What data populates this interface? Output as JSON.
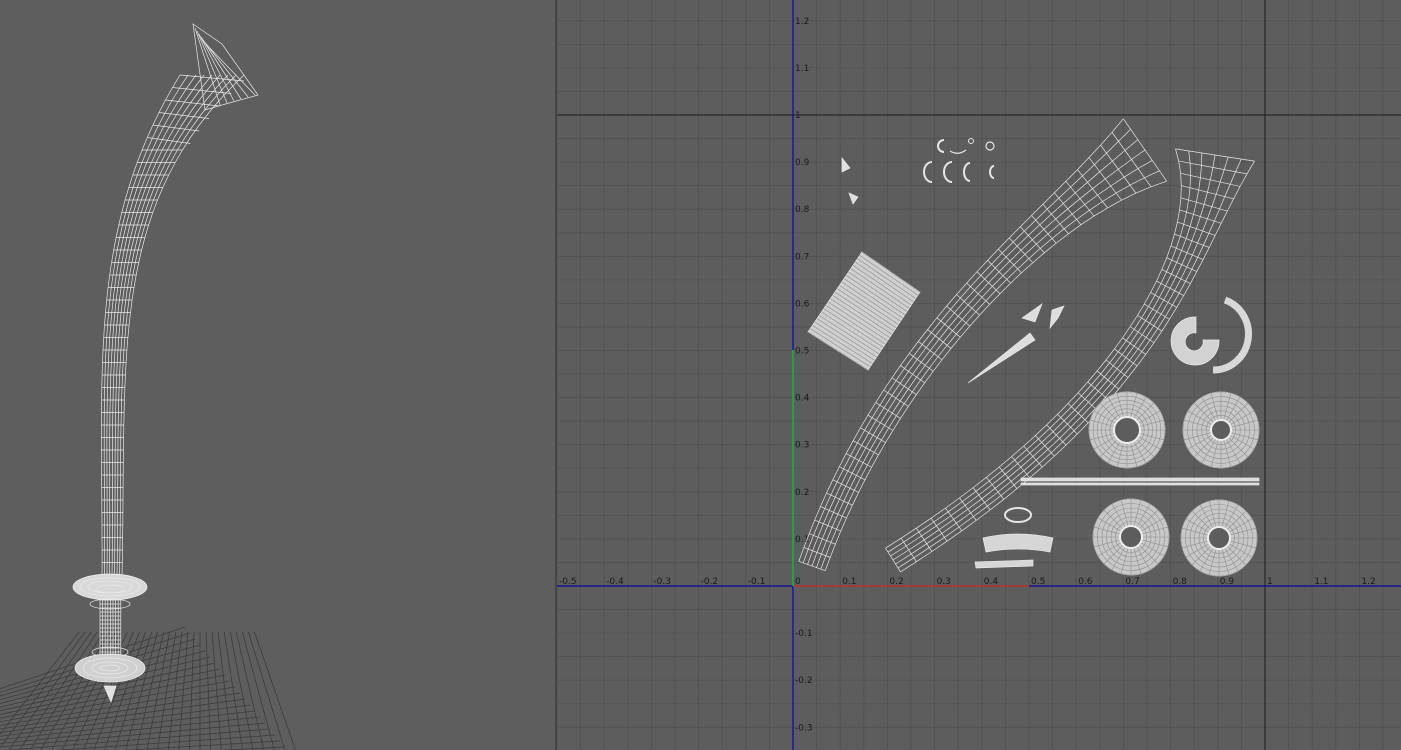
{
  "viewport_3d": {
    "object": "wireframe-sword-model",
    "wire_color": "#e8e8e8",
    "ground_grid_color": "#3a3a3a",
    "background_color": "#5e5e5e"
  },
  "uv_editor": {
    "background_color": "#5d5d5d",
    "grid_color": "#4f4f4f",
    "axis_color": "#0000a0",
    "u_axis_highlight": "#c0392b",
    "v_axis_highlight": "#27ae60",
    "uv_range_border": "#1a1a1a",
    "shell_color": "#e6e6e6",
    "x_ticks": [
      "-0.5",
      "-0.4",
      "-0.3",
      "-0.2",
      "-0.1",
      "0",
      "0.1",
      "0.2",
      "0.3",
      "0.4",
      "0.5",
      "0.6",
      "0.7",
      "0.8",
      "0.9",
      "1",
      "1.1",
      "1.2"
    ],
    "y_ticks": [
      "1.2",
      "1.1",
      "1",
      "0.9",
      "0.8",
      "0.7",
      "0.6",
      "0.5",
      "0.4",
      "0.3",
      "0.2",
      "0.1",
      "-0.1",
      "-0.2",
      "-0.3"
    ]
  }
}
